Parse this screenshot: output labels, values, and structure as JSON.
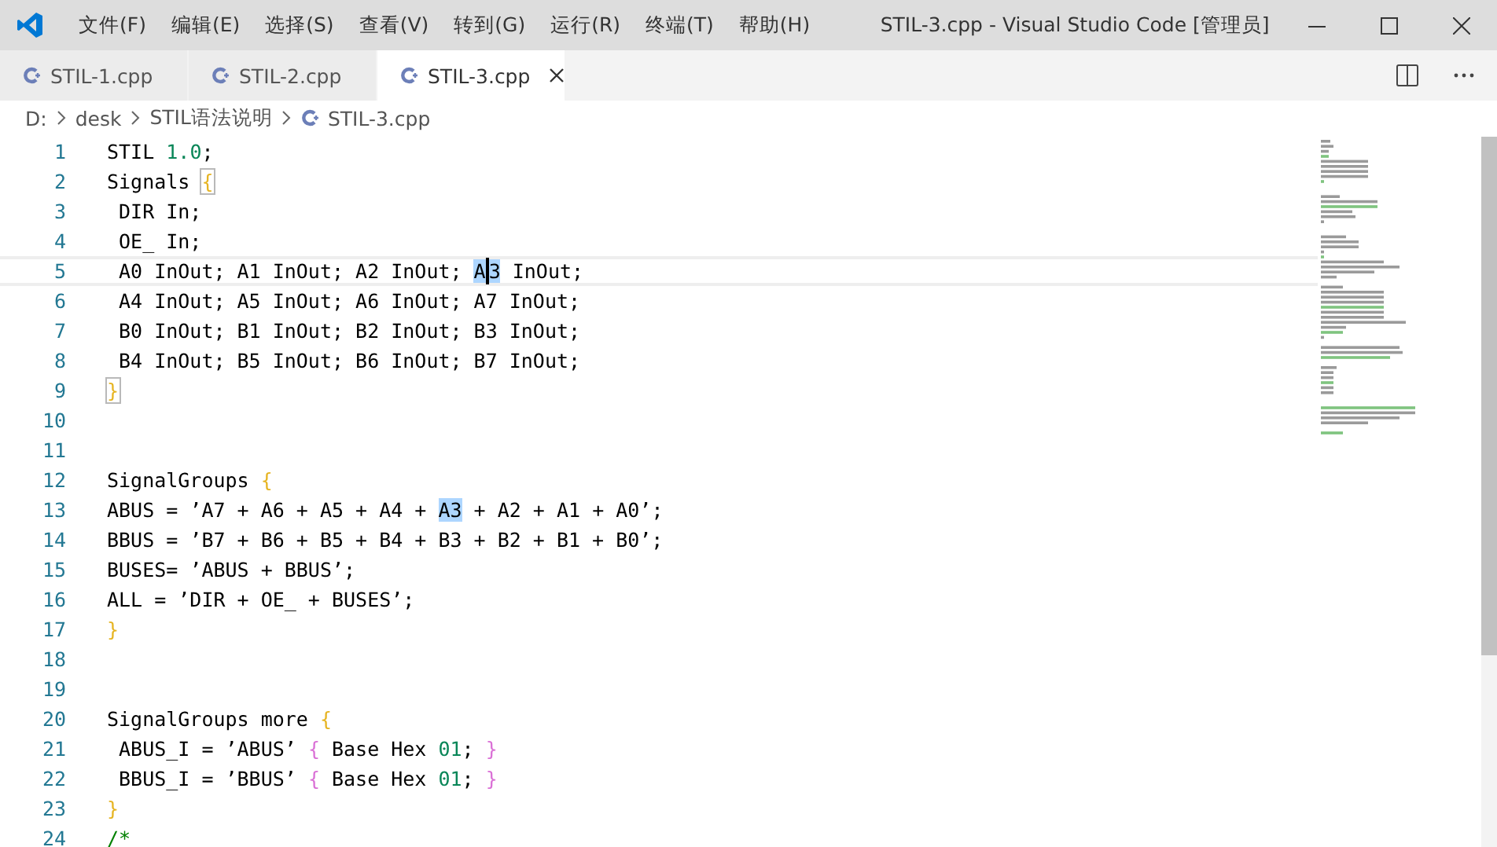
{
  "window": {
    "title": "STIL-3.cpp - Visual Studio Code [管理员]"
  },
  "menu": [
    "文件(F)",
    "编辑(E)",
    "选择(S)",
    "查看(V)",
    "转到(G)",
    "运行(R)",
    "终端(T)",
    "帮助(H)"
  ],
  "tabs": [
    {
      "label": "STIL-1.cpp",
      "selected": false
    },
    {
      "label": "STIL-2.cpp",
      "selected": false
    },
    {
      "label": "STIL-3.cpp",
      "selected": true
    }
  ],
  "breadcrumbs": [
    "D:",
    "desk",
    "STIL语法说明",
    "STIL-3.cpp"
  ],
  "lines": [
    {
      "number": "1",
      "current": false,
      "tokens": [
        {
          "t": "STIL ",
          "kind": "plain"
        },
        {
          "t": "1.0",
          "kind": "number"
        },
        {
          "t": ";",
          "kind": "plain"
        }
      ]
    },
    {
      "number": "2",
      "current": false,
      "tokens": [
        {
          "t": "Signals ",
          "kind": "plain"
        },
        {
          "t": "{",
          "kind": "brace_match"
        }
      ]
    },
    {
      "number": "3",
      "current": false,
      "tokens": [
        {
          "t": " DIR In;",
          "kind": "plain"
        }
      ]
    },
    {
      "number": "4",
      "current": false,
      "tokens": [
        {
          "t": " OE_ In;",
          "kind": "plain"
        }
      ]
    },
    {
      "number": "5",
      "current": true,
      "tokens": [
        {
          "t": " A0 InOut; A1 InOut; A2 InOut; ",
          "kind": "plain"
        },
        {
          "t": "A",
          "kind": "highlight"
        },
        {
          "kind": "cursor"
        },
        {
          "t": "3",
          "kind": "highlight"
        },
        {
          "t": " InOut;",
          "kind": "plain"
        }
      ]
    },
    {
      "number": "6",
      "current": false,
      "tokens": [
        {
          "t": " A4 InOut; A5 InOut; A6 InOut; A7 InOut;",
          "kind": "plain"
        }
      ]
    },
    {
      "number": "7",
      "current": false,
      "tokens": [
        {
          "t": " B0 InOut; B1 InOut; B2 InOut; B3 InOut;",
          "kind": "plain"
        }
      ]
    },
    {
      "number": "8",
      "current": false,
      "tokens": [
        {
          "t": " B4 InOut; B5 InOut; B6 InOut; B7 InOut;",
          "kind": "plain"
        }
      ]
    },
    {
      "number": "9",
      "current": false,
      "tokens": [
        {
          "t": "}",
          "kind": "brace_match"
        }
      ]
    },
    {
      "number": "10",
      "current": false
    },
    {
      "number": "11",
      "current": false
    },
    {
      "number": "12",
      "current": false,
      "tokens": [
        {
          "t": "SignalGroups ",
          "kind": "plain"
        },
        {
          "t": "{",
          "kind": "brace"
        }
      ]
    },
    {
      "number": "13",
      "current": false,
      "tokens": [
        {
          "t": "ABUS = ’A7 + A6 + A5 + A4 + ",
          "kind": "plain"
        },
        {
          "t": "A3",
          "kind": "highlight"
        },
        {
          "t": " + A2 + A1 + A0’;",
          "kind": "plain"
        }
      ]
    },
    {
      "number": "14",
      "current": false,
      "tokens": [
        {
          "t": "BBUS = ’B7 + B6 + B5 + B4 + B3 + B2 + B1 + B0’;",
          "kind": "plain"
        }
      ]
    },
    {
      "number": "15",
      "current": false,
      "tokens": [
        {
          "t": "BUSES= ’ABUS + BBUS’;",
          "kind": "plain"
        }
      ]
    },
    {
      "number": "16",
      "current": false,
      "tokens": [
        {
          "t": "ALL = ’DIR + OE_ + BUSES’;",
          "kind": "plain"
        }
      ]
    },
    {
      "number": "17",
      "current": false,
      "tokens": [
        {
          "t": "}",
          "kind": "brace"
        }
      ]
    },
    {
      "number": "18",
      "current": false
    },
    {
      "number": "19",
      "current": false
    },
    {
      "number": "20",
      "current": false,
      "tokens": [
        {
          "t": "SignalGroups more ",
          "kind": "plain"
        },
        {
          "t": "{",
          "kind": "brace"
        }
      ]
    },
    {
      "number": "21",
      "current": false,
      "tokens": [
        {
          "t": " ABUS_I = ’ABUS’ ",
          "kind": "plain"
        },
        {
          "t": "{",
          "kind": "brace2"
        },
        {
          "t": " Base Hex ",
          "kind": "plain"
        },
        {
          "t": "01",
          "kind": "number"
        },
        {
          "t": "; ",
          "kind": "plain"
        },
        {
          "t": "}",
          "kind": "brace2"
        }
      ]
    },
    {
      "number": "22",
      "current": false,
      "tokens": [
        {
          "t": " BBUS_I = ’BBUS’ ",
          "kind": "plain"
        },
        {
          "t": "{",
          "kind": "brace2"
        },
        {
          "t": " Base Hex ",
          "kind": "plain"
        },
        {
          "t": "01",
          "kind": "number"
        },
        {
          "t": "; ",
          "kind": "plain"
        },
        {
          "t": "}",
          "kind": "brace2"
        }
      ]
    },
    {
      "number": "23",
      "current": false,
      "tokens": [
        {
          "t": "}",
          "kind": "brace"
        }
      ]
    },
    {
      "number": "24",
      "current": false,
      "tokens": [
        {
          "t": "/*",
          "kind": "comment"
        }
      ]
    }
  ]
}
